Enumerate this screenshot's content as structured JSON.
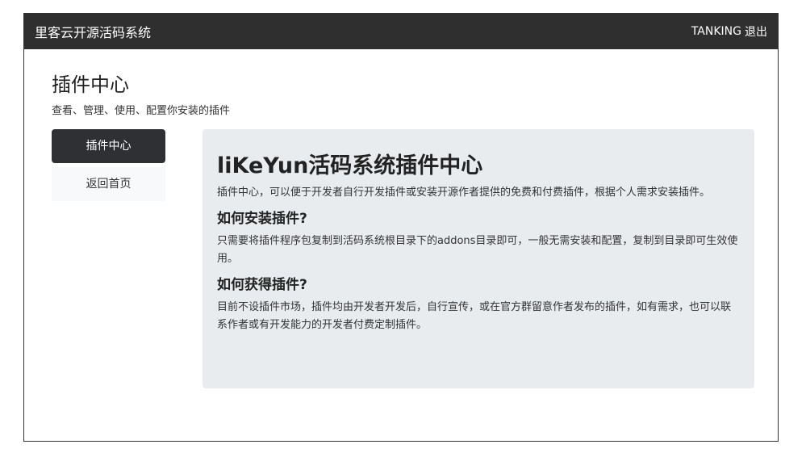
{
  "navbar": {
    "brand": "里客云开源活码系统",
    "user": "TANKING",
    "logout": "退出"
  },
  "header": {
    "title": "插件中心",
    "subtitle": "查看、管理、使用、配置你安装的插件"
  },
  "sidebar": {
    "items": [
      {
        "label": "插件中心",
        "active": true
      },
      {
        "label": "返回首页",
        "active": false
      }
    ]
  },
  "main": {
    "title": "liKeYun活码系统插件中心",
    "intro": "插件中心，可以便于开发者自行开发插件或安装开源作者提供的免费和付费插件，根据个人需求安装插件。",
    "sections": [
      {
        "heading": "如何安装插件?",
        "body": "只需要将插件程序包复制到活码系统根目录下的addons目录即可，一般无需安装和配置，复制到目录即可生效使用。"
      },
      {
        "heading": "如何获得插件?",
        "body": "目前不设插件市场，插件均由开发者开发后，自行宣传，或在官方群留意作者发布的插件，如有需求，也可以联系作者或有开发能力的开发者付费定制插件。"
      }
    ]
  },
  "colors": {
    "navbar_bg": "#2f2f2f",
    "sidebar_active_bg": "#2f3033",
    "panel_bg": "#e9ecef"
  }
}
